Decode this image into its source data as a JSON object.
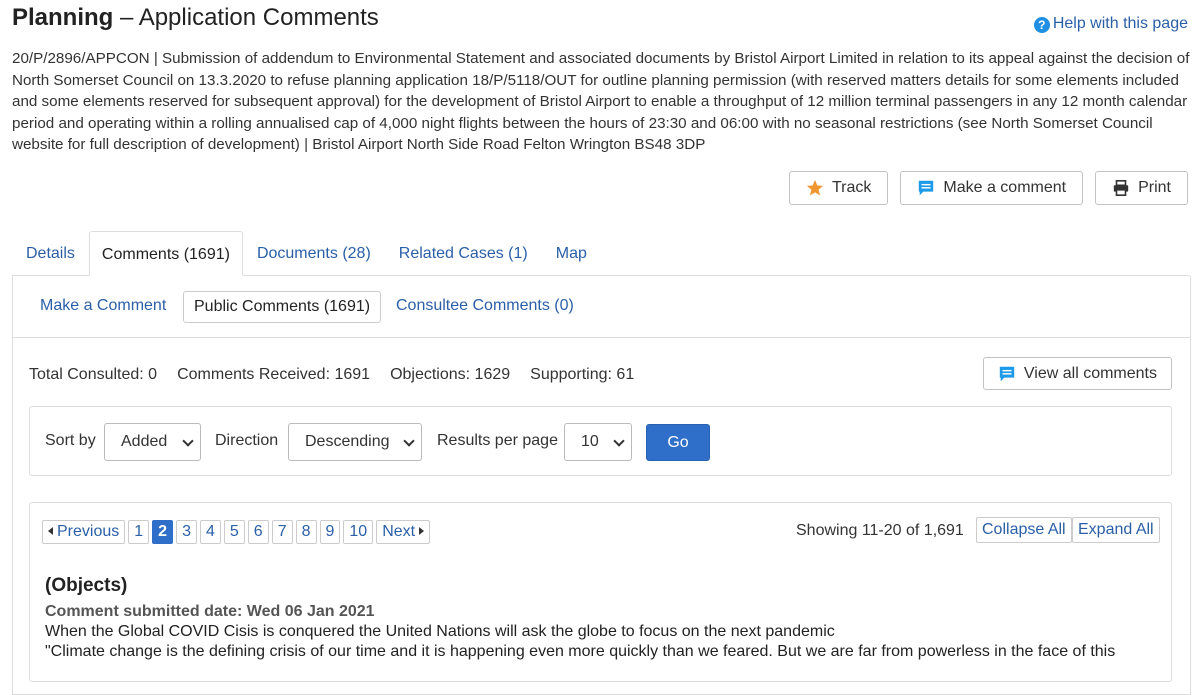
{
  "header": {
    "title_bold": "Planning",
    "title_rest": " – Application Comments",
    "help_label": "Help with this page"
  },
  "description": "20/P/2896/APPCON | Submission of addendum to Environmental Statement and associated documents by Bristol Airport Limited in relation to its appeal against the decision of North Somerset Council on 13.3.2020 to refuse planning application 18/P/5118/OUT for outline planning permission (with reserved matters details for some elements included and some elements reserved for subsequent approval) for the development of Bristol Airport to enable a throughput of 12 million terminal passengers in any 12 month calendar period and operating within a rolling annualised cap of 4,000 night flights between the hours of 23:30 and 06:00 with no seasonal restrictions (see North Somerset Council website for full description of development) | Bristol Airport North Side Road Felton Wrington BS48 3DP",
  "actions": {
    "track": "Track",
    "comment": "Make a comment",
    "print": "Print"
  },
  "tabs": [
    "Details",
    "Comments (1691)",
    "Documents (28)",
    "Related Cases (1)",
    "Map"
  ],
  "subtabs": [
    "Make a Comment",
    "Public Comments (1691)",
    "Consultee Comments (0)"
  ],
  "stats": {
    "consulted": "Total Consulted: 0",
    "received": "Comments Received: 1691",
    "objections": "Objections: 1629",
    "supporting": "Supporting: 61",
    "view_all": "View all comments"
  },
  "sort": {
    "sort_label": "Sort by",
    "sort_value": "Added",
    "direction_label": "Direction",
    "direction_value": "Descending",
    "rpp_label": "Results per page",
    "rpp_value": "10",
    "go": "Go"
  },
  "pager": {
    "previous": "Previous",
    "pages": [
      "1",
      "2",
      "3",
      "4",
      "5",
      "6",
      "7",
      "8",
      "9",
      "10"
    ],
    "current": "2",
    "next": "Next",
    "showing": "Showing 11-20 of 1,691",
    "collapse": "Collapse All",
    "expand": "Expand All"
  },
  "comment": {
    "stance": "(Objects)",
    "date": "Comment submitted date: Wed 06 Jan 2021",
    "line1": "When the Global COVID Cisis is conquered the United Nations will ask the globe to focus on the next pandemic",
    "line2": "\"Climate change is the defining crisis of our time and it is happening even more quickly than we feared. But we are far from powerless in the face of this"
  },
  "colors": {
    "link": "#2a5fa8",
    "primary": "#2f6fc9",
    "star": "#f0962e",
    "chat": "#1e9be8"
  }
}
